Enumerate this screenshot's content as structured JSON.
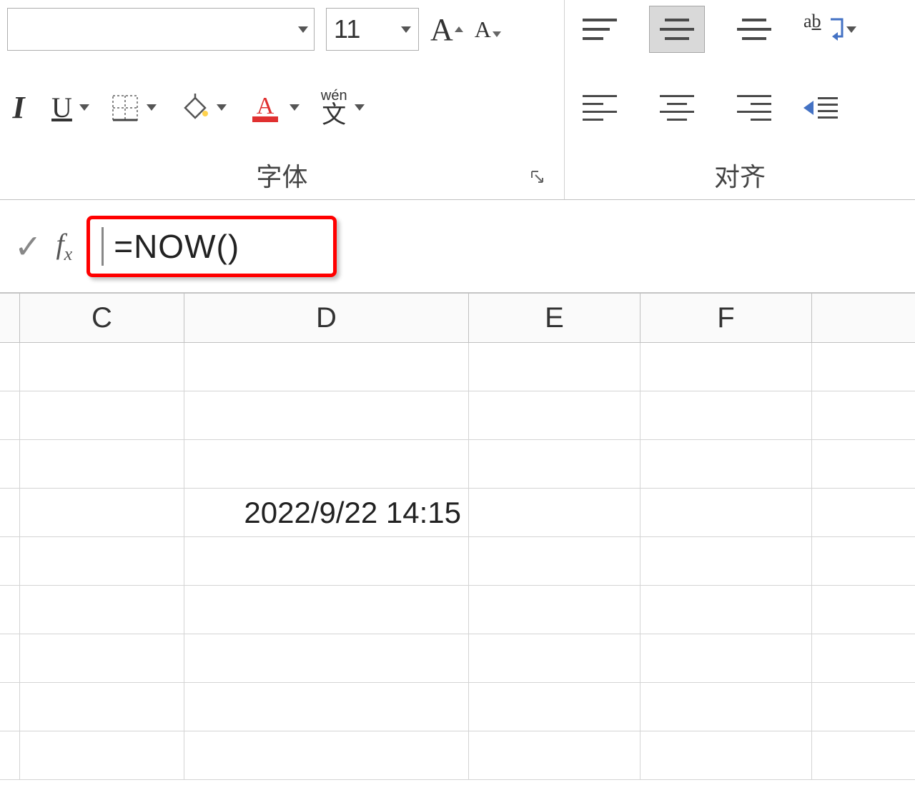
{
  "ribbon": {
    "font_size": "11",
    "group_font_label": "字体",
    "group_align_label": "对齐",
    "italic_label": "I",
    "underline_label": "U",
    "wen_pinyin": "wén",
    "wen_hanzi": "文",
    "wrap_ab_char_a": "a",
    "wrap_ab_char_b": "b"
  },
  "formula_bar": {
    "fx_f": "f",
    "fx_x": "x",
    "formula": "=NOW()"
  },
  "columns": [
    "C",
    "D",
    "E",
    "F"
  ],
  "cells": {
    "D_value": "2022/9/22 14:15"
  }
}
